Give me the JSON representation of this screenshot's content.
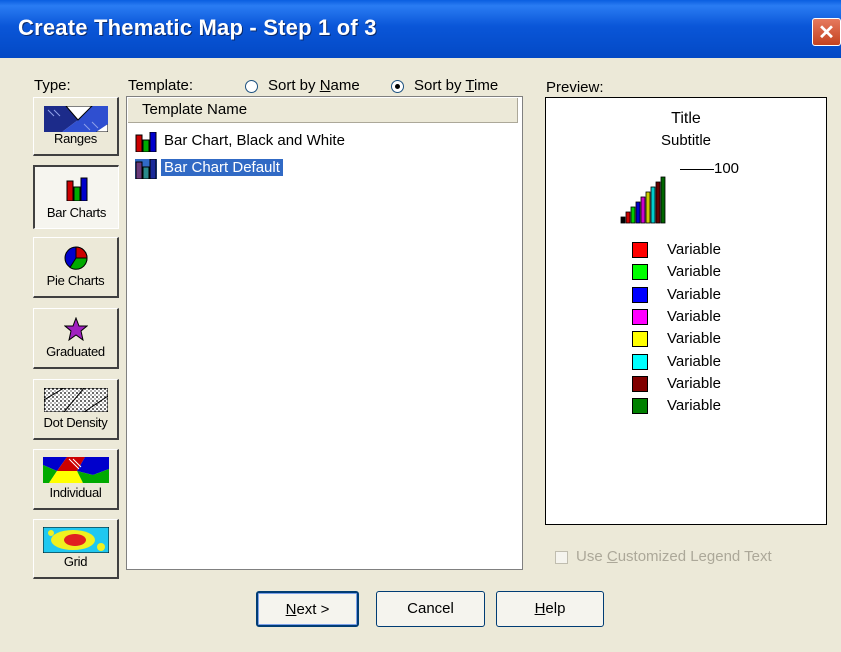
{
  "window": {
    "title": "Create Thematic Map - Step 1 of 3",
    "close_glyph": "✕"
  },
  "type_label": "Type:",
  "template_label": "Template:",
  "sort": {
    "by_name": {
      "prefix": "Sort by ",
      "key": "N",
      "rest": "ame",
      "selected": false
    },
    "by_time": {
      "prefix": "Sort by ",
      "key": "T",
      "rest": "ime",
      "selected": true
    }
  },
  "preview_label": "Preview:",
  "type_buttons": [
    {
      "label": "Ranges",
      "icon": "ranges-icon",
      "active": false
    },
    {
      "label": "Bar Charts",
      "icon": "bar-chart-icon",
      "active": true
    },
    {
      "label": "Pie Charts",
      "icon": "pie-chart-icon",
      "active": false
    },
    {
      "label": "Graduated",
      "icon": "star-icon",
      "active": false
    },
    {
      "label": "Dot Density",
      "icon": "dot-density-icon",
      "active": false
    },
    {
      "label": "Individual",
      "icon": "individual-icon",
      "active": false
    },
    {
      "label": "Grid",
      "icon": "grid-icon",
      "active": false
    }
  ],
  "template_list": {
    "column_header": "Template Name",
    "items": [
      {
        "label": "Bar Chart, Black and White",
        "selected": false
      },
      {
        "label": "Bar Chart Default",
        "selected": true
      }
    ]
  },
  "preview": {
    "title": "Title",
    "subtitle": "Subtitle",
    "scale_value": "100",
    "bar_colors": [
      "#000000",
      "#cc0000",
      "#00cc00",
      "#0000cc",
      "#cc00cc",
      "#cccc00",
      "#00cccc",
      "#660000",
      "#006600"
    ],
    "legend": [
      {
        "label": "Variable",
        "color": "#ff0000"
      },
      {
        "label": "Variable",
        "color": "#00ff00"
      },
      {
        "label": "Variable",
        "color": "#0000ff"
      },
      {
        "label": "Variable",
        "color": "#ff00ff"
      },
      {
        "label": "Variable",
        "color": "#ffff00"
      },
      {
        "label": "Variable",
        "color": "#00ffff"
      },
      {
        "label": "Variable",
        "color": "#800000"
      },
      {
        "label": "Variable",
        "color": "#008000"
      }
    ]
  },
  "customized_legend": {
    "prefix": "Use ",
    "key": "C",
    "rest": "ustomized Legend Text",
    "checked": false,
    "enabled": false
  },
  "buttons": {
    "next": {
      "key": "N",
      "rest": "ext >"
    },
    "cancel": {
      "label": "Cancel"
    },
    "help": {
      "key": "H",
      "rest": "elp"
    }
  }
}
